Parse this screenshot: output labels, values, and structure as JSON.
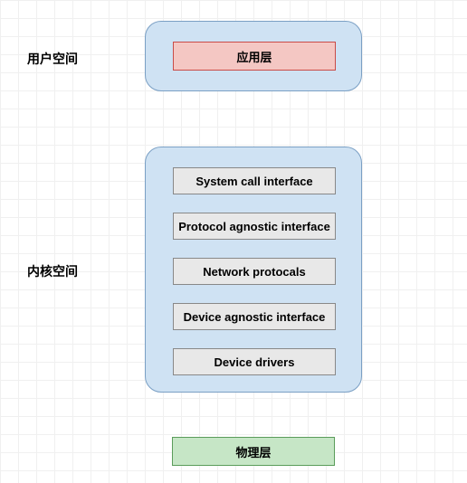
{
  "labels": {
    "user_space": "用户空间",
    "kernel_space": "内核空间"
  },
  "user_container": {
    "app_layer": "应用层"
  },
  "kernel_container": {
    "items": [
      "System call interface",
      "Protocol agnostic interface",
      "Network protocals",
      "Device agnostic interface",
      "Device drivers"
    ]
  },
  "physical_layer": "物理层"
}
